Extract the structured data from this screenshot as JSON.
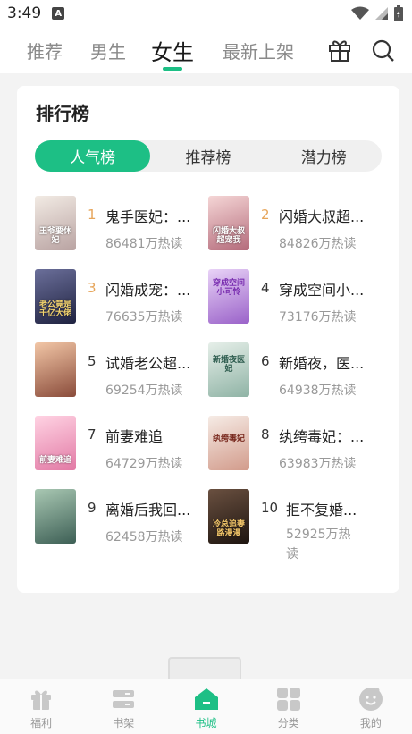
{
  "status_bar": {
    "time": "3:49",
    "notification_letter": "A"
  },
  "top_nav": {
    "tabs": [
      {
        "label": "推荐"
      },
      {
        "label": "男生"
      },
      {
        "label": "女生"
      },
      {
        "label": "最新上架"
      }
    ],
    "active_tab": "女生",
    "icons": [
      "gift-icon",
      "search-icon"
    ]
  },
  "ranking": {
    "title": "排行榜",
    "segments": [
      {
        "label": "人气榜"
      },
      {
        "label": "推荐榜"
      },
      {
        "label": "潜力榜"
      }
    ],
    "active_segment": "人气榜",
    "books": [
      {
        "rank": "1",
        "title": "鬼手医妃：...",
        "heat": "86481万热读",
        "cover_text": "王爷要休妃",
        "cover_color": "#d9c9c0"
      },
      {
        "rank": "2",
        "title": "闪婚大叔超...",
        "heat": "84826万热读",
        "cover_text": "闪婚大叔超宠我",
        "cover_color": "#e7b7bd"
      },
      {
        "rank": "3",
        "title": "闪婚成宠：...",
        "heat": "76635万热读",
        "cover_text": "老公竟是千亿大佬",
        "cover_color": "#3b3f63"
      },
      {
        "rank": "4",
        "title": "穿成空间小...",
        "heat": "73176万热读",
        "cover_text": "穿成空间小可怜",
        "cover_color": "#b58be0"
      },
      {
        "rank": "5",
        "title": "试婚老公超...",
        "heat": "69254万热读",
        "cover_text": "",
        "cover_color": "#c98d6c"
      },
      {
        "rank": "6",
        "title": "新婚夜，医...",
        "heat": "64938万热读",
        "cover_text": "新婚夜医妃",
        "cover_color": "#c7d6cf"
      },
      {
        "rank": "7",
        "title": "前妻难追",
        "heat": "64729万热读",
        "cover_text": "前妻难追",
        "cover_color": "#f1a9c4"
      },
      {
        "rank": "8",
        "title": "纨绔毒妃：...",
        "heat": "63983万热读",
        "cover_text": "纨绔毒妃",
        "cover_color": "#e9d2c8"
      },
      {
        "rank": "9",
        "title": "离婚后我回...",
        "heat": "62458万热读",
        "cover_text": "",
        "cover_color": "#5f8a6e"
      },
      {
        "rank": "10",
        "title": "拒不复婚...",
        "heat": "52925万热读",
        "cover_text": "冷总追妻路漫漫",
        "cover_color": "#4a3a30"
      }
    ]
  },
  "tabbar": {
    "items": [
      {
        "label": "福利",
        "icon": "gift-box-icon"
      },
      {
        "label": "书架",
        "icon": "bookshelf-icon"
      },
      {
        "label": "书城",
        "icon": "home-store-icon"
      },
      {
        "label": "分类",
        "icon": "grid-icon"
      },
      {
        "label": "我的",
        "icon": "profile-face-icon"
      }
    ],
    "active": "书城"
  },
  "colors": {
    "accent": "#1dbf85",
    "rank_top": "#e6a55a"
  }
}
